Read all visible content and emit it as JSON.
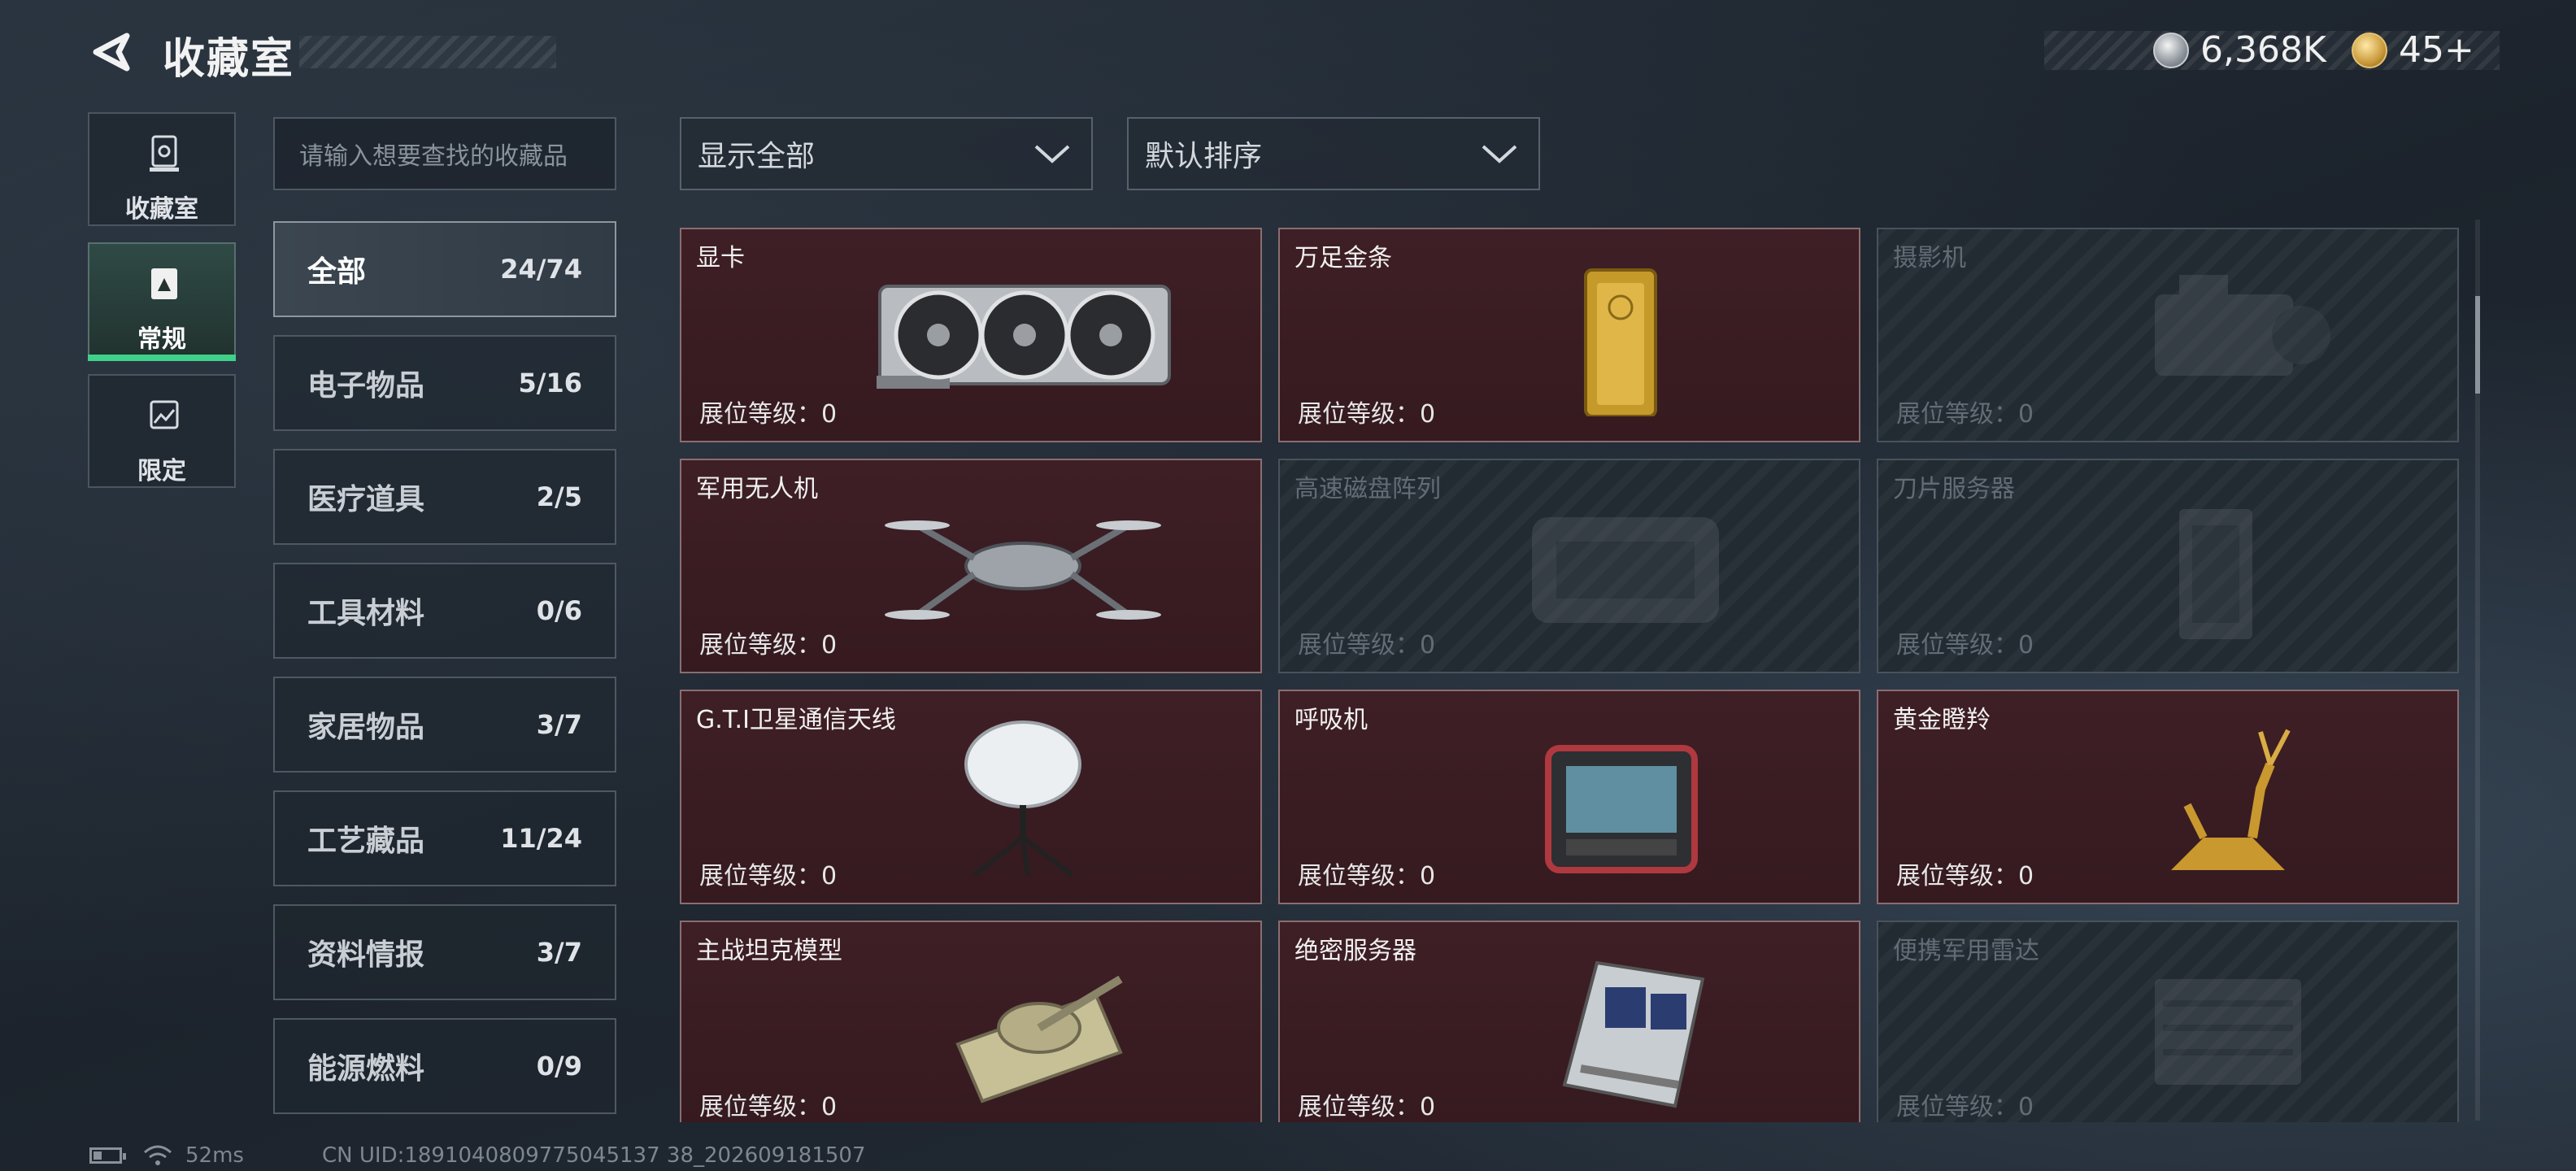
{
  "header": {
    "title": "收藏室",
    "currencies": [
      {
        "icon": "silver-coin-icon",
        "value": "6,368K"
      },
      {
        "icon": "gold-coin-icon",
        "value": "45+"
      }
    ]
  },
  "nav": {
    "tabs": [
      {
        "label": "收藏室",
        "icon": "collection-room-icon",
        "active": false
      },
      {
        "label": "常规",
        "icon": "regular-icon",
        "active": true
      },
      {
        "label": "限定",
        "icon": "limited-icon",
        "active": false
      }
    ]
  },
  "search": {
    "placeholder": "请输入想要查找的收藏品"
  },
  "categories": [
    {
      "name": "全部",
      "count": "24/74",
      "active": true
    },
    {
      "name": "电子物品",
      "count": "5/16"
    },
    {
      "name": "医疗道具",
      "count": "2/5"
    },
    {
      "name": "工具材料",
      "count": "0/6"
    },
    {
      "name": "家居物品",
      "count": "3/7"
    },
    {
      "name": "工艺藏品",
      "count": "11/24"
    },
    {
      "name": "资料情报",
      "count": "3/7"
    },
    {
      "name": "能源燃料",
      "count": "0/9"
    }
  ],
  "filters": {
    "display": "显示全部",
    "sort": "默认排序"
  },
  "items": [
    {
      "name": "显卡",
      "level": "展位等级：0",
      "unlocked": true,
      "art": "gpu"
    },
    {
      "name": "万足金条",
      "level": "展位等级：0",
      "unlocked": true,
      "art": "goldbar"
    },
    {
      "name": "摄影机",
      "level": "展位等级：0",
      "unlocked": false,
      "art": "camera"
    },
    {
      "name": "军用无人机",
      "level": "展位等级：0",
      "unlocked": true,
      "art": "drone"
    },
    {
      "name": "高速磁盘阵列",
      "level": "展位等级：0",
      "unlocked": false,
      "art": "diskarray"
    },
    {
      "name": "刀片服务器",
      "level": "展位等级：0",
      "unlocked": false,
      "art": "blade"
    },
    {
      "name": "G.T.I卫星通信天线",
      "level": "展位等级：0",
      "unlocked": true,
      "art": "satellite"
    },
    {
      "name": "呼吸机",
      "level": "展位等级：0",
      "unlocked": true,
      "art": "ventilator"
    },
    {
      "name": "黄金瞪羚",
      "level": "展位等级：0",
      "unlocked": true,
      "art": "gazelle"
    },
    {
      "name": "主战坦克模型",
      "level": "展位等级：0",
      "unlocked": true,
      "art": "tank"
    },
    {
      "name": "绝密服务器",
      "level": "展位等级：0",
      "unlocked": true,
      "art": "server"
    },
    {
      "name": "便携军用雷达",
      "level": "展位等级：0",
      "unlocked": false,
      "art": "radar"
    }
  ],
  "status": {
    "ping": "52ms",
    "uid": "CN UID:1891040809775045137 38_202609181507"
  }
}
